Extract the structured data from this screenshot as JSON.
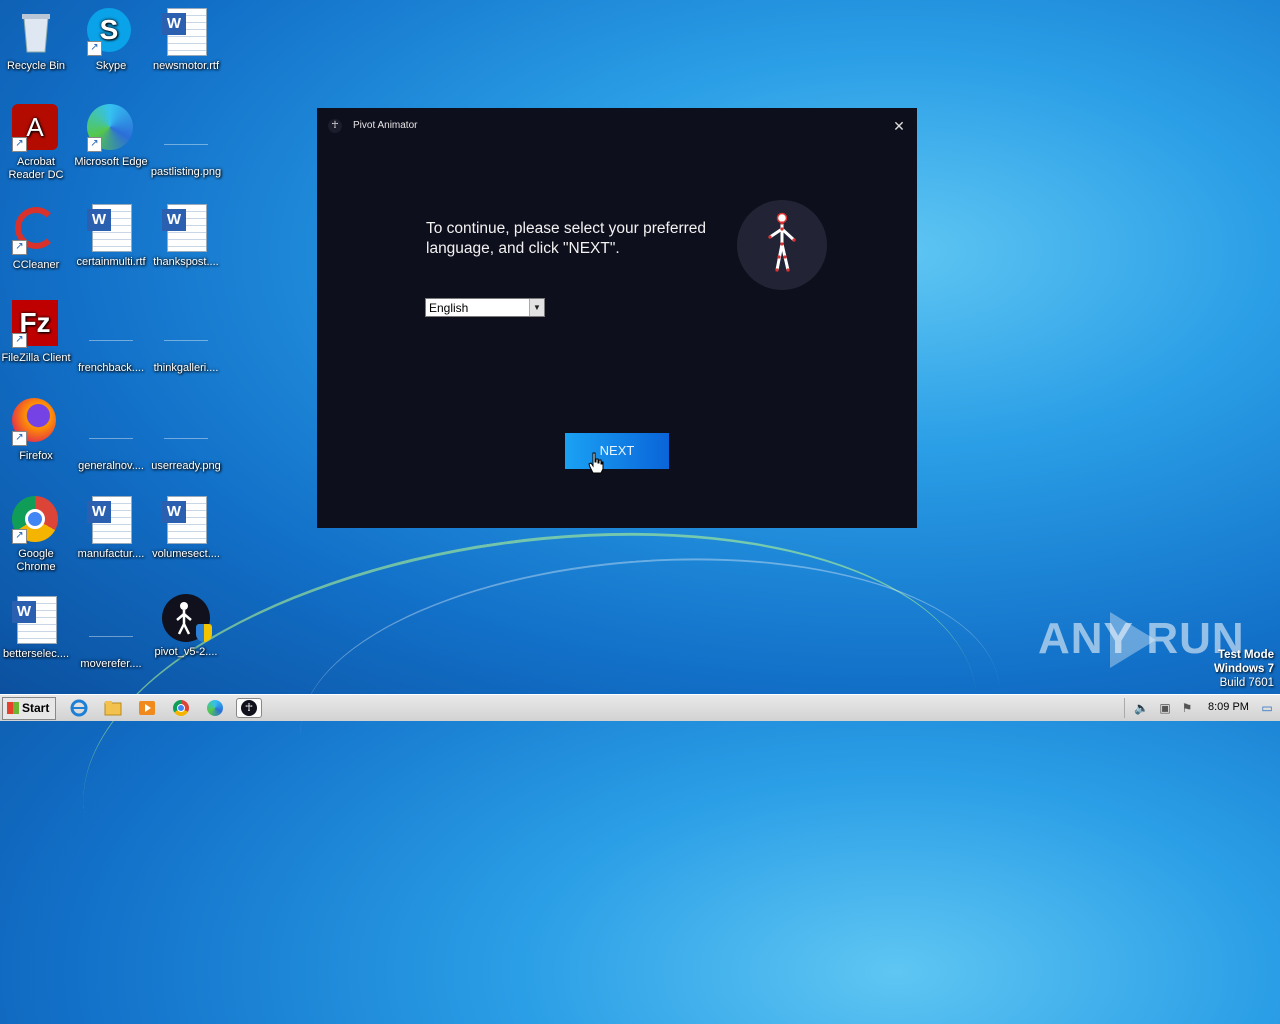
{
  "desktop": {
    "icons": [
      {
        "label": "Recycle Bin",
        "icon": "recycle-bin-icon"
      },
      {
        "label": "Skype",
        "icon": "skype-icon"
      },
      {
        "label": "newsmotor.rtf",
        "icon": "word-document-icon"
      },
      {
        "label": "Acrobat Reader DC",
        "icon": "acrobat-icon"
      },
      {
        "label": "Microsoft Edge",
        "icon": "edge-icon"
      },
      {
        "label": "pastlisting.png",
        "icon": "image-file-icon"
      },
      {
        "label": "CCleaner",
        "icon": "ccleaner-icon"
      },
      {
        "label": "certainmulti.rtf",
        "icon": "word-document-icon"
      },
      {
        "label": "thankspost....",
        "icon": "word-document-icon"
      },
      {
        "label": "FileZilla Client",
        "icon": "filezilla-icon"
      },
      {
        "label": "frenchback....",
        "icon": "image-file-icon"
      },
      {
        "label": "thinkgalleri....",
        "icon": "image-file-icon"
      },
      {
        "label": "Firefox",
        "icon": "firefox-icon"
      },
      {
        "label": "generalnov....",
        "icon": "image-file-icon"
      },
      {
        "label": "userready.png",
        "icon": "image-file-icon"
      },
      {
        "label": "Google Chrome",
        "icon": "chrome-icon"
      },
      {
        "label": "manufactur....",
        "icon": "word-document-icon"
      },
      {
        "label": "volumesect....",
        "icon": "word-document-icon"
      },
      {
        "label": "betterselec....",
        "icon": "word-document-icon"
      },
      {
        "label": "moverefer....",
        "icon": "image-file-icon"
      },
      {
        "label": "pivot_v5-2....",
        "icon": "pivot-installer-icon"
      }
    ]
  },
  "window": {
    "title": "Pivot Animator",
    "prompt": "To continue, please select your preferred language, and click \"NEXT\".",
    "language_selected": "English",
    "next_label": "NEXT"
  },
  "watermark": {
    "text": "ANY  RUN"
  },
  "system_info": {
    "line1": "Test Mode",
    "line2": "Windows 7",
    "line3": "Build 7601"
  },
  "taskbar": {
    "start_label": "Start",
    "pinned": [
      "internet-explorer-icon",
      "folder-icon",
      "media-player-icon",
      "chrome-icon",
      "edge-icon",
      "pivot-icon"
    ],
    "clock": "8:09 PM"
  },
  "colors": {
    "window_bg": "#0e0f1c",
    "button_start": "#1aa2f4",
    "button_end": "#0a64d8"
  }
}
